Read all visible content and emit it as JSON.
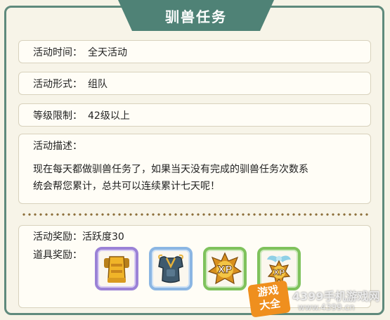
{
  "title": "驯兽任务",
  "activity_time": {
    "label": "活动时间：",
    "value": "全天活动"
  },
  "activity_form": {
    "label": "活动形式：",
    "value": "组队"
  },
  "level_limit": {
    "label": "等级限制：",
    "value": "42级以上"
  },
  "description": {
    "label": "活动描述：",
    "line1": "现在每天都做驯兽任务了，如果当天没有完成的驯兽任务次数系",
    "line2": "统会帮您累计，总共可以连续累计七天呢！"
  },
  "rewards": {
    "activity_label": "活动奖励：",
    "activity_value": "活跃度30",
    "items_label": "道具奖励：",
    "items": [
      {
        "icon": "gold-armor-icon",
        "frame_color": "#9b82d6"
      },
      {
        "icon": "blue-armor-icon",
        "frame_color": "#8bb6e3"
      },
      {
        "icon": "xp-badge-icon",
        "frame_color": "#7fc25c"
      },
      {
        "icon": "winged-xp-badge-icon",
        "frame_color": "#7fc25c"
      }
    ]
  },
  "watermark": {
    "logo_line1": "游戏",
    "logo_line2": "大全",
    "text": "4399手机游戏网",
    "url": "www.4399.cn"
  }
}
